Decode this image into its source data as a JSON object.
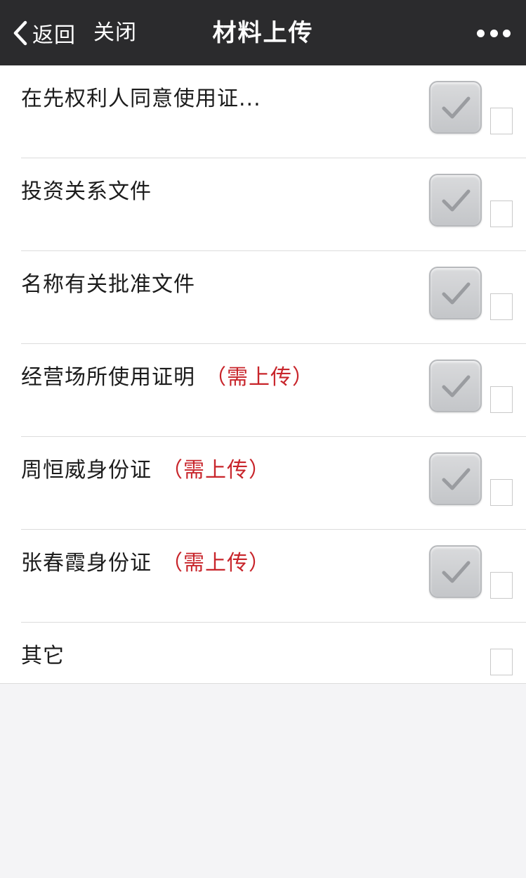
{
  "navbar": {
    "back_label": "返回",
    "close_label": "关闭",
    "title": "材料上传"
  },
  "items": [
    {
      "label": "在先权利人同意使用证...",
      "required": "",
      "has_thumbnail": true,
      "checked": false
    },
    {
      "label": "投资关系文件",
      "required": "",
      "has_thumbnail": true,
      "checked": false
    },
    {
      "label": "名称有关批准文件",
      "required": "",
      "has_thumbnail": true,
      "checked": false
    },
    {
      "label": "经营场所使用证明",
      "required": "（需上传）",
      "has_thumbnail": true,
      "checked": false
    },
    {
      "label": "周恒威身份证",
      "required": "（需上传）",
      "has_thumbnail": true,
      "checked": false
    },
    {
      "label": "张春霞身份证",
      "required": "（需上传）",
      "has_thumbnail": true,
      "checked": false
    },
    {
      "label": "其它",
      "required": "",
      "has_thumbnail": false,
      "checked": false
    }
  ],
  "colors": {
    "navbar_bg": "#2b2b2d",
    "required_text": "#c8252b",
    "page_bg": "#f4f4f6"
  },
  "icons": {
    "back": "chevron-left-icon",
    "more": "more-dots-icon",
    "thumbnail": "checkmark-thumbnail-icon"
  }
}
